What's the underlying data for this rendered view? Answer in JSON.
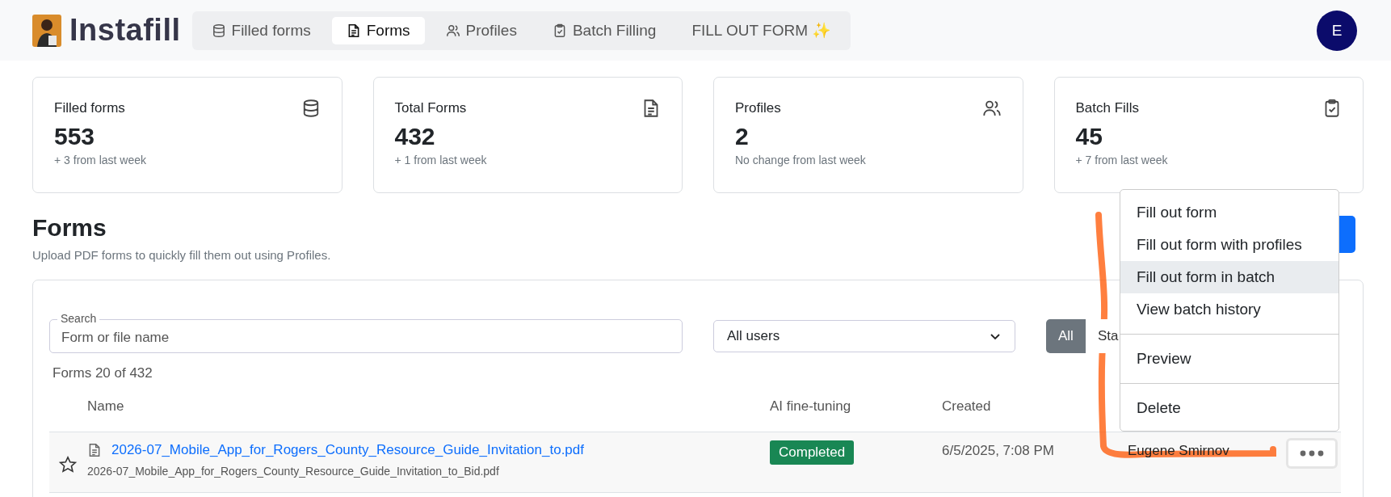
{
  "app": {
    "name": "Instafill"
  },
  "nav": [
    {
      "label": "Filled forms",
      "kind": "database",
      "selected": false
    },
    {
      "label": "Forms",
      "kind": "file",
      "selected": true
    },
    {
      "label": "Profiles",
      "kind": "users",
      "selected": false
    },
    {
      "label": "Batch Filling",
      "kind": "clipboard",
      "selected": false
    },
    {
      "label": "FILL OUT FORM ✨",
      "kind": "action",
      "selected": false
    }
  ],
  "user": {
    "initial": "E"
  },
  "stats": [
    {
      "title": "Filled forms",
      "value": "553",
      "note": "+ 3 from last week",
      "kind": "database"
    },
    {
      "title": "Total Forms",
      "value": "432",
      "note": "+ 1 from last week",
      "kind": "file"
    },
    {
      "title": "Profiles",
      "value": "2",
      "note": "No change from last week",
      "kind": "users"
    },
    {
      "title": "Batch Fills",
      "value": "45",
      "note": "+ 7 from last week",
      "kind": "clipboard"
    }
  ],
  "forms": {
    "title": "Forms",
    "subtitle": "Upload PDF forms to quickly fill them out using Profiles."
  },
  "filters": {
    "search": {
      "label": "Search",
      "placeholder": "Form or file name"
    },
    "user_select": "All users",
    "toggle": [
      {
        "label": "All",
        "selected": true
      },
      {
        "label": "Sta",
        "selected": false
      }
    ]
  },
  "count": "Forms 20 of 432",
  "table": {
    "columns": [
      "Name",
      "AI fine-tuning",
      "Created"
    ],
    "rows": [
      {
        "starred": false,
        "title": "2026-07_Mobile_App_for_Rogers_County_Resource_Guide_Invitation_to.pdf",
        "file": "2026-07_Mobile_App_for_Rogers_County_Resource_Guide_Invitation_to_Bid.pdf",
        "status": "Completed",
        "created": "6/5/2025, 7:08 PM",
        "owner": "Eugene Smirnov"
      }
    ]
  },
  "menu": [
    [
      {
        "label": "Fill out form",
        "selected": false
      },
      {
        "label": "Fill out form with profiles",
        "selected": false
      },
      {
        "label": "Fill out form in batch",
        "selected": true
      },
      {
        "label": "View batch history",
        "selected": false
      }
    ],
    [
      {
        "label": "Preview",
        "selected": false
      }
    ],
    [
      {
        "label": "Delete",
        "selected": false
      }
    ]
  ]
}
